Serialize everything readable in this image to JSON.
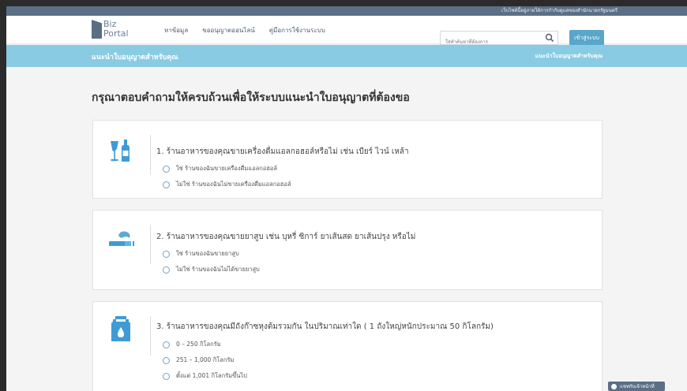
{
  "topbar": {
    "text": "เว็บไซต์นี้อยู่ภายใต้การกำกับดูแลของสำนักนายกรัฐมนตรี"
  },
  "logo": {
    "line1": "Biz",
    "line2": "Portal"
  },
  "nav": [
    "หาข้อมูล",
    "ขออนุญาตออนไลน์",
    "คู่มือการใช้งานระบบ"
  ],
  "search": {
    "placeholder": "ใส่คำค้นหาที่ต้องการ"
  },
  "login_label": "เข้าสู่ระบบ",
  "banner": {
    "title": "แนะนำใบอนุญาตสำหรับคุณ",
    "breadcrumb": "แนะนำใบอนุญาตสำหรับคุณ"
  },
  "heading": "กรุณาตอบคำถามให้ครบถ้วนเพื่อให้ระบบแนะนำใบอนุญาตที่ต้องขอ",
  "questions": [
    {
      "text": "1. ร้านอาหารของคุณขายเครื่องดื่มแอลกอฮอล์หรือไม่ เช่น เบียร์ ไวน์ เหล้า",
      "icon": "alcohol-icon",
      "options": [
        "ใช่ ร้านของฉันขายเครื่องดื่มแอลกอฮอล์",
        "ไม่ใช่ ร้านของฉันไม่ขายเครื่องดื่มแอลกอฮอล์"
      ]
    },
    {
      "text": "2. ร้านอาหารของคุณขายยาสูบ เช่น บุหรี่ ซิการ์ ยาเส้นสด ยาเส้นปรุง หรือไม่",
      "icon": "cigarette-icon",
      "options": [
        "ใช่ ร้านของฉันขายยาสูบ",
        "ไม่ใช่ ร้านของฉันไม่ได้ขายยาสูบ"
      ]
    },
    {
      "text": "3. ร้านอาหารของคุณมีถังก๊าซหุงต้มรวมกัน ในปริมาณเท่าใด ( 1 ถังใหญ่หนักประมาณ 50 กิโลกรัม)",
      "icon": "gas-tank-icon",
      "options": [
        "0 – 250 กิโลกรัม",
        "251 – 1,000 กิโลกรัม",
        "ตั้งแต่ 1,001 กิโลกรัมขึ้นไป"
      ]
    }
  ],
  "chat_label": "แชทกับเจ้าหน้าที่",
  "colors": {
    "accent": "#89cbe3",
    "icon": "#3f9bd6",
    "topbar": "#5b6f86"
  }
}
